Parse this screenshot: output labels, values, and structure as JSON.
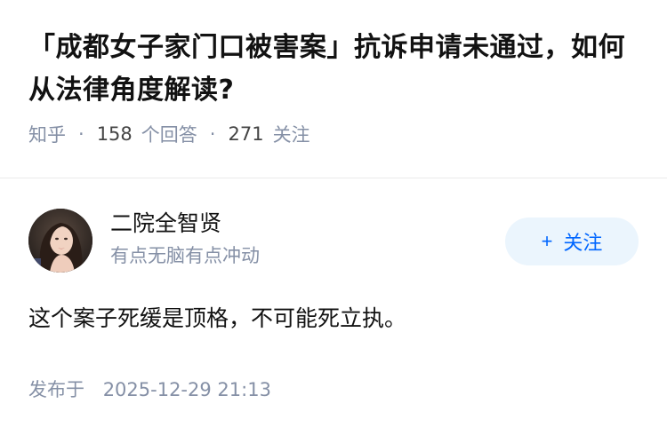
{
  "question": {
    "title": "「成都女子家门口被害案」抗诉申请未通过，如何从法律角度解读?",
    "source": "知乎",
    "answer_count": "158",
    "answer_label": "个回答",
    "follower_count": "271",
    "follower_label": "关注"
  },
  "answer": {
    "author": {
      "name": "二院全智贤",
      "bio": "有点无脑有点冲动",
      "avatar_icon": "avatar-photo"
    },
    "follow_button": {
      "plus": "+",
      "label": "关注"
    },
    "content": "这个案子死缓是顶格，不可能死立执。",
    "published_label": "发布于",
    "published_time": "2025-12-29 21:13"
  },
  "colors": {
    "primary_text": "#121212",
    "secondary_text": "#8590a6",
    "follow_bg": "#ebf5fd",
    "follow_text": "#0066ff",
    "divider": "#ebebeb"
  }
}
